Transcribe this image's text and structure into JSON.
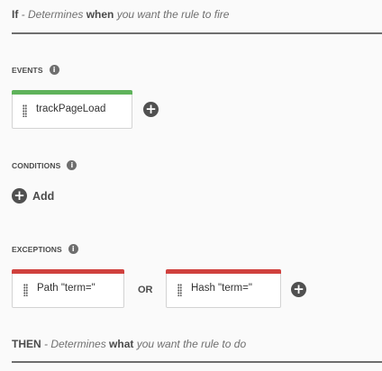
{
  "if_header": {
    "keyword": "If",
    "text_before": " - Determines ",
    "emphasis": "when",
    "text_after": " you want the rule to fire"
  },
  "events": {
    "label": "EVENTS",
    "info_icon": "info-icon",
    "cards": [
      {
        "label": "trackPageLoad",
        "accent": "#5fb35b"
      }
    ],
    "add_icon": "plus-circle-icon"
  },
  "conditions": {
    "label": "CONDITIONS",
    "info_icon": "info-icon",
    "add_label": "Add"
  },
  "exceptions": {
    "label": "EXCEPTIONS",
    "info_icon": "info-icon",
    "cards": [
      {
        "label": "Path \"term=\"",
        "accent": "#d0413e"
      },
      {
        "label": "Hash \"term=\"",
        "accent": "#d0413e"
      }
    ],
    "or_label": "OR",
    "add_icon": "plus-circle-icon"
  },
  "then_header": {
    "keyword": "THEN",
    "text_before": " - Determines ",
    "emphasis": "what",
    "text_after": " you want the rule to do"
  }
}
